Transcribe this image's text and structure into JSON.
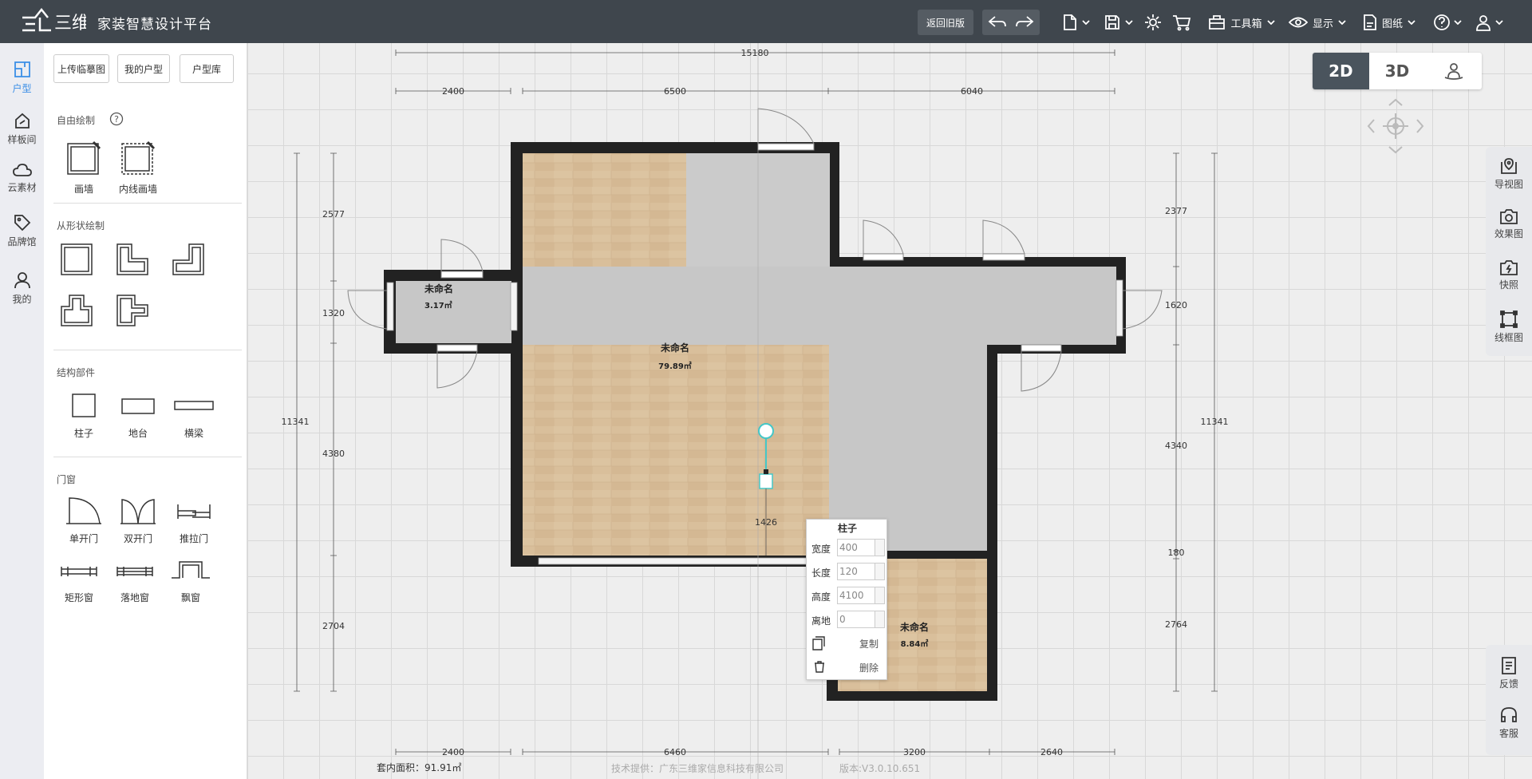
{
  "app": {
    "title": "家装智慧设计平台",
    "logo_text": "三维家"
  },
  "topbar": {
    "back_old": "返回旧版",
    "toolbox": "工具箱",
    "display": "显示",
    "drawings": "图纸"
  },
  "leftnav": [
    {
      "label": "户型",
      "icon": "floorplan-icon"
    },
    {
      "label": "样板间",
      "icon": "template-icon"
    },
    {
      "label": "云素材",
      "icon": "cloud-icon"
    },
    {
      "label": "品牌馆",
      "icon": "tag-icon"
    },
    {
      "label": "我的",
      "icon": "user-icon"
    }
  ],
  "panel": {
    "buttons": [
      "上传临摹图",
      "我的户型",
      "户型库"
    ],
    "free_draw": "自由绘制",
    "free_tools": [
      "画墙",
      "内线画墙"
    ],
    "shape_draw": "从形状绘制",
    "structure": "结构部件",
    "structure_tools": [
      "柱子",
      "地台",
      "横梁"
    ],
    "doorwin": "门窗",
    "door_tools": [
      "单开门",
      "双开门",
      "推拉门"
    ],
    "window_tools": [
      "矩形窗",
      "落地窗",
      "飘窗"
    ]
  },
  "view_toggle": {
    "2d": "2D",
    "3d": "3D"
  },
  "rightbar": [
    "导视图",
    "效果图",
    "快照",
    "线框图"
  ],
  "rightbar2": [
    "反馈",
    "客服"
  ],
  "dims": {
    "top_total": "15180",
    "top_1": "2400",
    "top_2": "6500",
    "top_3": "6040",
    "bottom_1": "2400",
    "bottom_2": "6460",
    "bottom_3": "3200",
    "bottom_4": "2640",
    "left_total": "11341",
    "left_1": "2577",
    "left_2": "1320",
    "left_3": "4380",
    "left_4": "2704",
    "right_total": "11341",
    "right_1": "2377",
    "right_2": "1620",
    "right_3": "4340",
    "right_4": "180",
    "right_5": "2764",
    "pillar": "1426"
  },
  "rooms": [
    {
      "name": "未命名",
      "area": "3.17㎡"
    },
    {
      "name": "未命名",
      "area": "79.89㎡"
    },
    {
      "name": "未命名",
      "area": "8.84㎡"
    }
  ],
  "popup": {
    "title": "柱子",
    "fields": [
      {
        "label": "宽度",
        "value": "400"
      },
      {
        "label": "长度",
        "value": "120"
      },
      {
        "label": "高度",
        "value": "4100"
      },
      {
        "label": "离地",
        "value": "0"
      }
    ],
    "copy": "复制",
    "delete": "删除"
  },
  "status": {
    "area": "套内面积：91.91㎡",
    "credit": "技术提供：广东三维家信息科技有限公司",
    "version": "版本:V3.0.10.651"
  }
}
